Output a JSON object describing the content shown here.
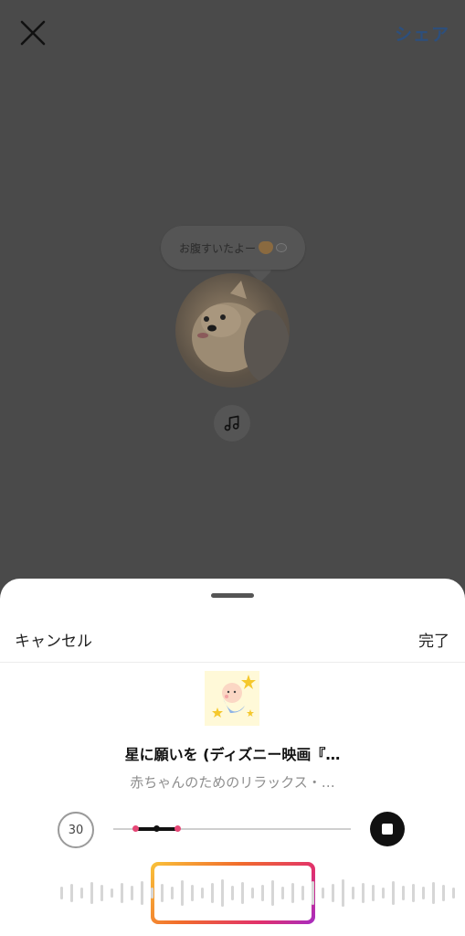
{
  "header": {
    "share_label": "シェア"
  },
  "preview": {
    "bubble_text": "お腹すいたよー"
  },
  "sheet": {
    "cancel_label": "キャンセル",
    "done_label": "完了"
  },
  "song": {
    "title": "星に願いを (ディズニー映画『…",
    "artist": "赤ちゃんのためのリラックス・…"
  },
  "player": {
    "duration": "30"
  },
  "colors": {
    "share": "#2d4f7c",
    "accent_pink": "#e64776",
    "gradient_start": "#f9c33a",
    "gradient_end": "#a52cc3"
  }
}
